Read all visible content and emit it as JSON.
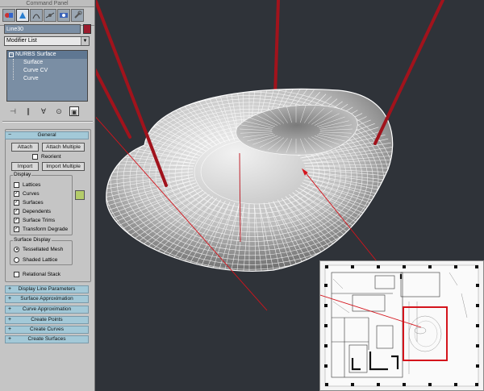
{
  "panel": {
    "title": "Command Panel",
    "tabs": [
      {
        "name": "create",
        "icon": "create-icon"
      },
      {
        "name": "modify",
        "icon": "modify-icon"
      },
      {
        "name": "hierarchy",
        "icon": "hierarchy-icon"
      },
      {
        "name": "motion",
        "icon": "motion-icon"
      },
      {
        "name": "display",
        "icon": "display-icon"
      },
      {
        "name": "utilities",
        "icon": "utilities-icon"
      }
    ],
    "object_name": "Line30",
    "object_color": "#9c1b2c",
    "modifier_list": "Modifier List",
    "stack": {
      "root": "NURBS Surface",
      "children": [
        "Surface",
        "Curve CV",
        "Curve"
      ]
    }
  },
  "general": {
    "header": "General",
    "attach": "Attach",
    "attach_multiple": "Attach Multiple",
    "reorient": "Reorient",
    "import": "Import",
    "import_multiple": "Import Multiple",
    "display_group": "Display",
    "display_options": [
      {
        "label": "Lattices",
        "checked": false
      },
      {
        "label": "Curves",
        "checked": true
      },
      {
        "label": "Surfaces",
        "checked": true
      },
      {
        "label": "Dependents",
        "checked": true
      },
      {
        "label": "Surface Trims",
        "checked": true
      },
      {
        "label": "Transform Degrade",
        "checked": true
      }
    ],
    "surface_display_group": "Surface Display",
    "surface_display_options": [
      {
        "label": "Tessellated Mesh",
        "selected": true
      },
      {
        "label": "Shaded Lattice",
        "selected": false
      }
    ],
    "relational_stack": "Relational Stack"
  },
  "rollouts": [
    "Display Line Parameters",
    "Surface Approximation",
    "Curve Approximation",
    "Create Points",
    "Create Curves",
    "Create Surfaces"
  ],
  "colors": {
    "viewport_bg": "#2f3339",
    "panel_bg": "#c5c5c5",
    "rollout_bar": "#a3c9d8",
    "stack_bg": "#7a8ea4",
    "support_lines": "#a1131c",
    "highlight_box": "#d4141c"
  }
}
